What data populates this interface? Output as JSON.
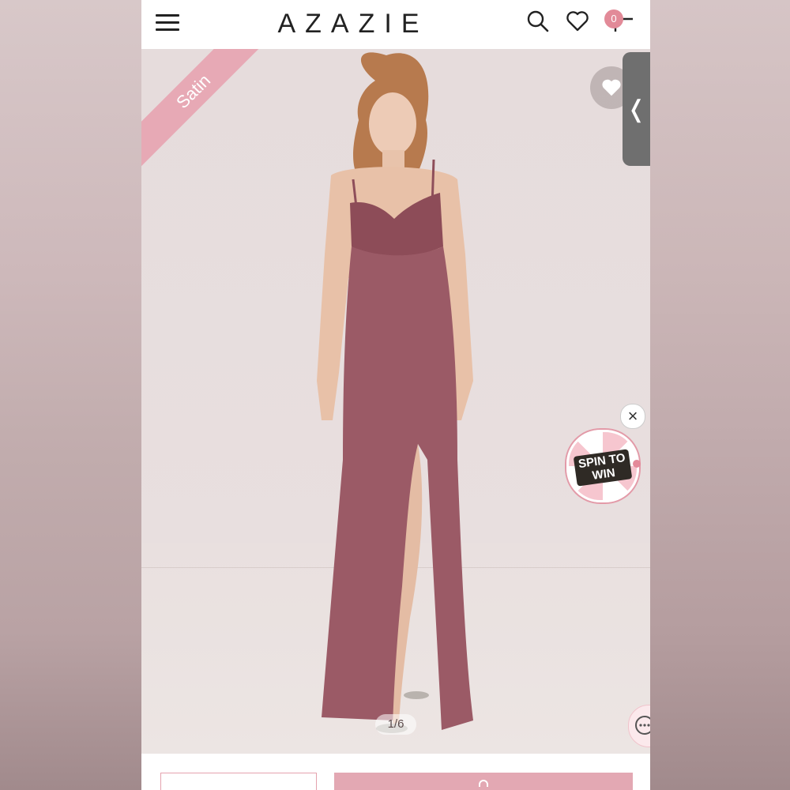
{
  "header": {
    "logo": "AZAZIE",
    "cart_count": "0"
  },
  "hero": {
    "ribbon": "Satin",
    "image_counter": "1/6",
    "promo_label": "SPIN TO WIN",
    "close_glyph": "×",
    "side_tab_glyph": "❬"
  },
  "icons": {
    "menu": "hamburger-icon",
    "search": "search-icon",
    "wishlist": "heart-icon",
    "cart": "cart-icon",
    "favorite": "heart-icon",
    "chat": "chat-icon",
    "close": "close-icon"
  },
  "colors": {
    "accent_pink": "#e3a8b3",
    "ribbon_pink": "#e7a9b5",
    "dress": "#9b5a66",
    "text_dark": "#222222"
  }
}
